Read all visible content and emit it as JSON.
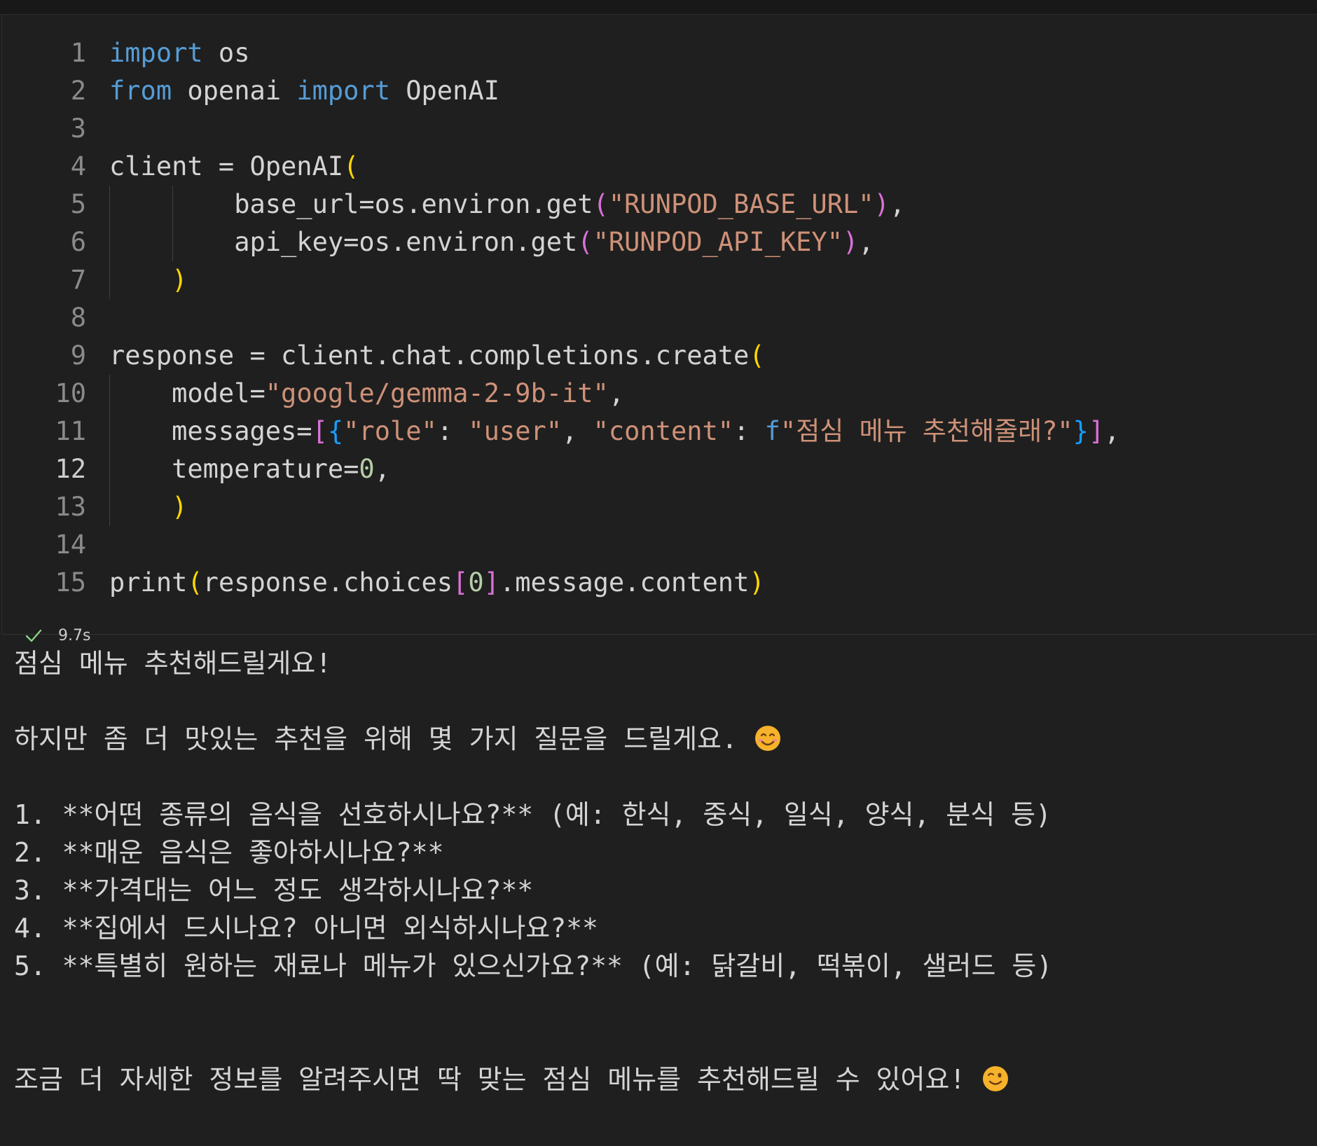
{
  "code": {
    "lines": [
      {
        "n": "1",
        "tokens": [
          {
            "t": "import",
            "c": "kw"
          },
          {
            "t": " os",
            "c": ""
          }
        ]
      },
      {
        "n": "2",
        "tokens": [
          {
            "t": "from",
            "c": "kw"
          },
          {
            "t": " openai ",
            "c": ""
          },
          {
            "t": "import",
            "c": "kw"
          },
          {
            "t": " OpenAI",
            "c": ""
          }
        ]
      },
      {
        "n": "3",
        "tokens": []
      },
      {
        "n": "4",
        "tokens": [
          {
            "t": "client = OpenAI",
            "c": ""
          },
          {
            "t": "(",
            "c": "b1"
          }
        ]
      },
      {
        "n": "5",
        "tokens": [
          {
            "t": "        base_url=os.environ.get",
            "c": ""
          },
          {
            "t": "(",
            "c": "b2"
          },
          {
            "t": "\"RUNPOD_BASE_URL\"",
            "c": "str"
          },
          {
            "t": ")",
            "c": "b2"
          },
          {
            "t": ",",
            "c": ""
          }
        ]
      },
      {
        "n": "6",
        "tokens": [
          {
            "t": "        api_key=os.environ.get",
            "c": ""
          },
          {
            "t": "(",
            "c": "b2"
          },
          {
            "t": "\"RUNPOD_API_KEY\"",
            "c": "str"
          },
          {
            "t": ")",
            "c": "b2"
          },
          {
            "t": ",",
            "c": ""
          }
        ]
      },
      {
        "n": "7",
        "tokens": [
          {
            "t": "    ",
            "c": ""
          },
          {
            "t": ")",
            "c": "b1"
          }
        ]
      },
      {
        "n": "8",
        "tokens": []
      },
      {
        "n": "9",
        "tokens": [
          {
            "t": "response = client.chat.completions.create",
            "c": ""
          },
          {
            "t": "(",
            "c": "b1"
          }
        ]
      },
      {
        "n": "10",
        "tokens": [
          {
            "t": "    model=",
            "c": ""
          },
          {
            "t": "\"google/gemma-2-9b-it\"",
            "c": "str"
          },
          {
            "t": ",",
            "c": ""
          }
        ]
      },
      {
        "n": "11",
        "tokens": [
          {
            "t": "    messages=",
            "c": ""
          },
          {
            "t": "[",
            "c": "b2"
          },
          {
            "t": "{",
            "c": "b3"
          },
          {
            "t": "\"role\"",
            "c": "str"
          },
          {
            "t": ": ",
            "c": ""
          },
          {
            "t": "\"user\"",
            "c": "str"
          },
          {
            "t": ", ",
            "c": ""
          },
          {
            "t": "\"content\"",
            "c": "str"
          },
          {
            "t": ": ",
            "c": ""
          },
          {
            "t": "f",
            "c": "kw"
          },
          {
            "t": "\"점심 메뉴 추천해줄래?\"",
            "c": "str"
          },
          {
            "t": "}",
            "c": "b3"
          },
          {
            "t": "]",
            "c": "b2"
          },
          {
            "t": ",",
            "c": ""
          }
        ]
      },
      {
        "n": "12",
        "tokens": [
          {
            "t": "    temperature=",
            "c": ""
          },
          {
            "t": "0",
            "c": "num"
          },
          {
            "t": ",",
            "c": ""
          }
        ]
      },
      {
        "n": "13",
        "tokens": [
          {
            "t": "    ",
            "c": ""
          },
          {
            "t": ")",
            "c": "b1"
          }
        ]
      },
      {
        "n": "14",
        "tokens": []
      },
      {
        "n": "15",
        "tokens": [
          {
            "t": "print",
            "c": ""
          },
          {
            "t": "(",
            "c": "b1"
          },
          {
            "t": "response.choices",
            "c": ""
          },
          {
            "t": "[",
            "c": "b2"
          },
          {
            "t": "0",
            "c": "num"
          },
          {
            "t": "]",
            "c": "b2"
          },
          {
            "t": ".message.content",
            "c": ""
          },
          {
            "t": ")",
            "c": "b1"
          }
        ]
      }
    ],
    "active_line": "12"
  },
  "status": {
    "icon": "check-icon",
    "time": "9.7s",
    "color": "#89d185"
  },
  "output": {
    "lines": [
      {
        "text": "점심 메뉴 추천해드릴게요!",
        "emoji": ""
      },
      {
        "text": "",
        "emoji": ""
      },
      {
        "text": "하지만 좀 더 맛있는 추천을 위해 몇 가지 질문을 드릴게요. ",
        "emoji": "smiling-face-icon"
      },
      {
        "text": "",
        "emoji": ""
      },
      {
        "text": "1. **어떤 종류의 음식을 선호하시나요?** (예: 한식, 중식, 일식, 양식, 분식 등)",
        "emoji": ""
      },
      {
        "text": "2. **매운 음식은 좋아하시나요?**",
        "emoji": ""
      },
      {
        "text": "3. **가격대는 어느 정도 생각하시나요?**",
        "emoji": ""
      },
      {
        "text": "4. **집에서 드시나요? 아니면 외식하시나요?**",
        "emoji": ""
      },
      {
        "text": "5. **특별히 원하는 재료나 메뉴가 있으신가요?** (예: 닭갈비, 떡볶이, 샐러드 등)",
        "emoji": ""
      },
      {
        "text": "",
        "emoji": ""
      },
      {
        "text": "",
        "emoji": ""
      },
      {
        "text": "조금 더 자세한 정보를 알려주시면 딱 맞는 점심 메뉴를 추천해드릴 수 있어요! ",
        "emoji": "winking-face-icon"
      }
    ]
  }
}
